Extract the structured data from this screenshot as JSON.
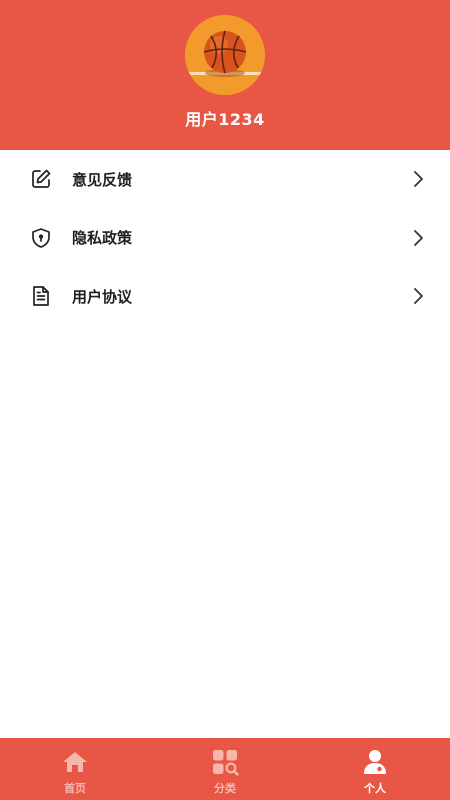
{
  "profile": {
    "username": "用户1234",
    "avatar_icon": "basketball-icon"
  },
  "menu": {
    "items": [
      {
        "label": "意见反馈",
        "icon": "edit-icon"
      },
      {
        "label": "隐私政策",
        "icon": "shield-icon"
      },
      {
        "label": "用户协议",
        "icon": "document-icon"
      }
    ]
  },
  "tabbar": {
    "tabs": [
      {
        "label": "首页",
        "icon": "home-icon",
        "active": false
      },
      {
        "label": "分类",
        "icon": "category-icon",
        "active": false
      },
      {
        "label": "个人",
        "icon": "user-icon",
        "active": true
      }
    ]
  },
  "colors": {
    "brand": "#e85746",
    "tab_inactive": "#f7b6ac",
    "tab_active": "#ffffff"
  }
}
